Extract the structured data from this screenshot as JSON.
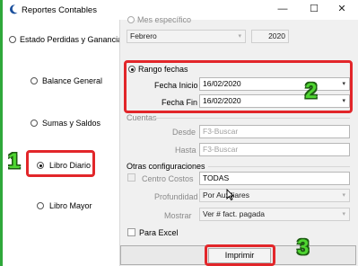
{
  "window": {
    "title": "Reportes Contables",
    "controls": {
      "minimize": "—",
      "maximize": "☐",
      "close": "✕"
    }
  },
  "report_types": [
    {
      "label": "Estado Perdidas y Ganancias",
      "selected": false
    },
    {
      "label": "Balance General",
      "selected": false
    },
    {
      "label": "Sumas y Saldos",
      "selected": false
    },
    {
      "label": "Libro Diario",
      "selected": true
    },
    {
      "label": "Libro Mayor",
      "selected": false
    }
  ],
  "mes_especifico": {
    "label": "Mes específico",
    "month_value": "Febrero",
    "year_value": "2020"
  },
  "rango_fechas": {
    "label": "Rango fechas",
    "fecha_inicio_label": "Fecha Inicio",
    "fecha_inicio_value": "16/02/2020",
    "fecha_fin_label": "Fecha Fin",
    "fecha_fin_value": "16/02/2020"
  },
  "cuentas": {
    "label": "Cuentas",
    "desde_label": "Desde",
    "desde_placeholder": "F3-Buscar",
    "hasta_label": "Hasta",
    "hasta_placeholder": "F3-Buscar"
  },
  "otras": {
    "label": "Otras configuraciones",
    "centro_costos_label": "Centro Costos",
    "centro_costos_value": "TODAS",
    "profundidad_label": "Profundidad",
    "profundidad_value": "Por Auxiliares",
    "mostrar_label": "Mostrar",
    "mostrar_value": "Ver # fact. pagada",
    "para_excel_label": "Para Excel"
  },
  "imprimir_label": "Imprimir",
  "annotations": {
    "one": "1",
    "two": "2",
    "three": "3"
  },
  "colors": {
    "highlight": "#e2262a",
    "annotation": "#4fd631",
    "edge": "#2fa83a"
  }
}
